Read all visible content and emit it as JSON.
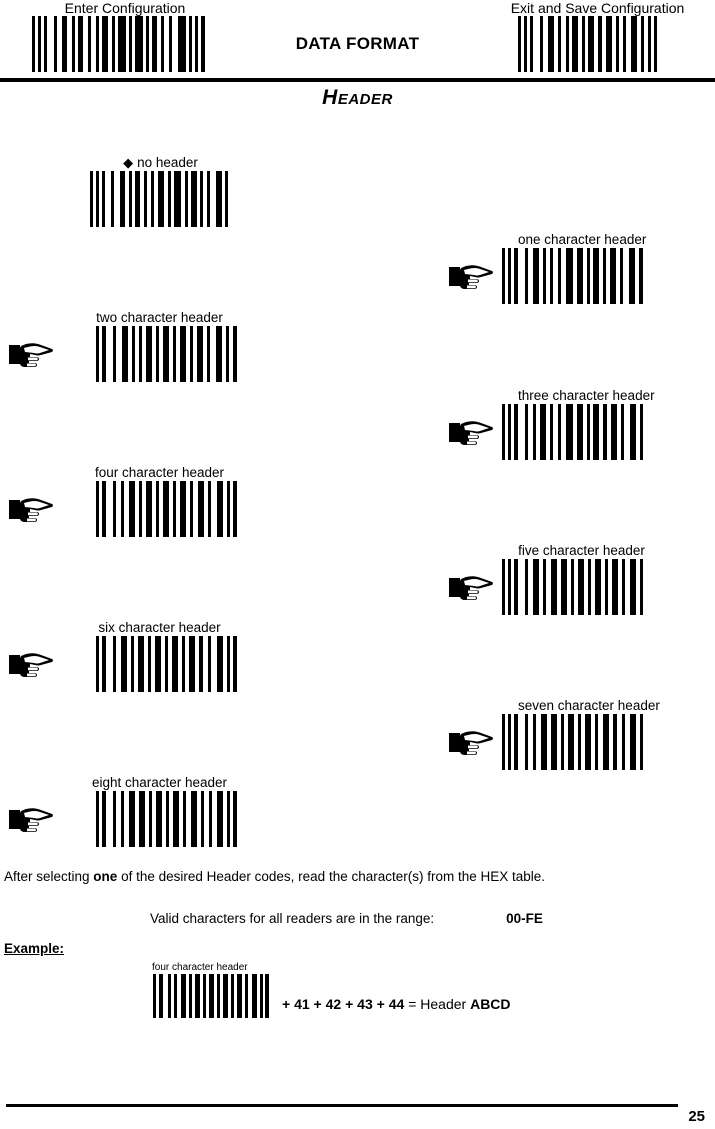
{
  "header_bar": {
    "enter_config_label": "Enter Configuration",
    "exit_config_label": "Exit and Save Configuration",
    "document_title": "DATA FORMAT"
  },
  "section": {
    "title": "Header"
  },
  "options": [
    {
      "label": "no header",
      "marker": "diamond",
      "marker_glyph": "◆",
      "default": true,
      "side": "left"
    },
    {
      "label": "one character header",
      "marker": "hand",
      "default": false,
      "side": "right"
    },
    {
      "label": "two character header",
      "marker": "hand",
      "default": false,
      "side": "left"
    },
    {
      "label": "three character header",
      "marker": "hand",
      "default": false,
      "side": "right"
    },
    {
      "label": "four character header",
      "marker": "hand",
      "default": false,
      "side": "left"
    },
    {
      "label": "five character header",
      "marker": "hand",
      "default": false,
      "side": "right"
    },
    {
      "label": "six character header",
      "marker": "hand",
      "default": false,
      "side": "left"
    },
    {
      "label": "seven character header",
      "marker": "hand",
      "default": false,
      "side": "right"
    },
    {
      "label": "eight character header",
      "marker": "hand",
      "default": false,
      "side": "left"
    }
  ],
  "notes": {
    "after_selecting_pre": "After selecting ",
    "after_selecting_bold": "one",
    "after_selecting_post": " of the desired Header codes, read the character(s) from the HEX table.",
    "valid_chars_label": "Valid characters for all readers are in the range:",
    "valid_chars_range": "00-FE"
  },
  "example": {
    "label": "Example:",
    "barcode_caption": "four character header",
    "plus1": "+",
    "hex1": "41",
    "plus2": "+",
    "hex2": "42",
    "plus3": "+",
    "hex3": "43",
    "plus4": "+",
    "hex4": "44",
    "equals": "=",
    "result_label": "Header",
    "result_value": "ABCD"
  },
  "footer": {
    "page_number": "25"
  },
  "icons": {
    "hand_pointer": "pointing-hand-right"
  },
  "colors": {
    "ink": "#000000",
    "paper": "#ffffff"
  }
}
